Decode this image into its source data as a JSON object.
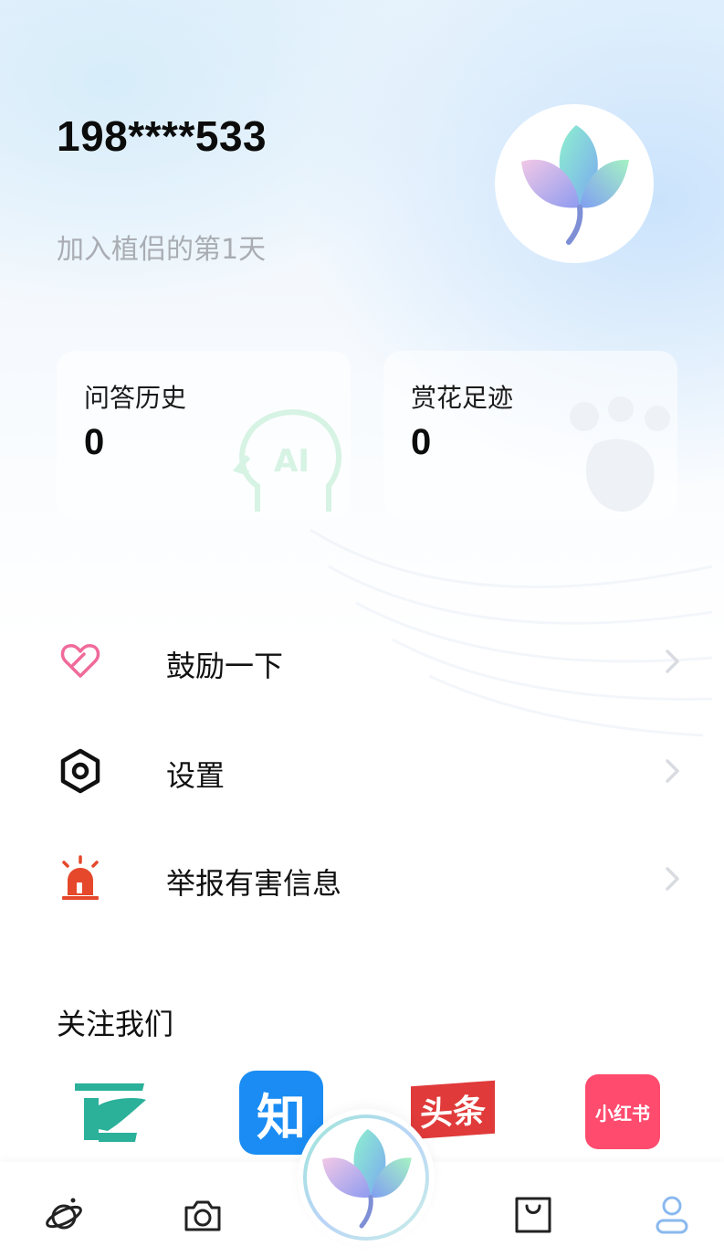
{
  "profile": {
    "phone": "198****533",
    "join_text": "加入植侣的第1天"
  },
  "stats": [
    {
      "label": "问答历史",
      "value": "0"
    },
    {
      "label": "赏花足迹",
      "value": "0"
    }
  ],
  "menu": [
    {
      "label": "鼓励一下",
      "icon": "heart-icon",
      "color": "#f06a9a"
    },
    {
      "label": "设置",
      "icon": "settings-hex-icon",
      "color": "#111111"
    },
    {
      "label": "举报有害信息",
      "icon": "alarm-siren-icon",
      "color": "#e5482b"
    }
  ],
  "follow": {
    "title": "关注我们",
    "platforms": [
      {
        "name": "baidu-baike",
        "label": "百",
        "color": "#2bb09a"
      },
      {
        "name": "zhihu",
        "label": "知",
        "color": "#1a8cf3"
      },
      {
        "name": "toutiao",
        "label": "头条",
        "color": "#e03a3a"
      },
      {
        "name": "xiaohongshu",
        "label": "小红书",
        "color": "#ff4b6e"
      }
    ]
  },
  "tabbar": {
    "items": [
      "planet-icon",
      "camera-icon",
      "plant-logo-icon",
      "shopping-bag-icon",
      "user-icon"
    ],
    "active": "user-icon",
    "active_color": "#8ab9ef"
  }
}
